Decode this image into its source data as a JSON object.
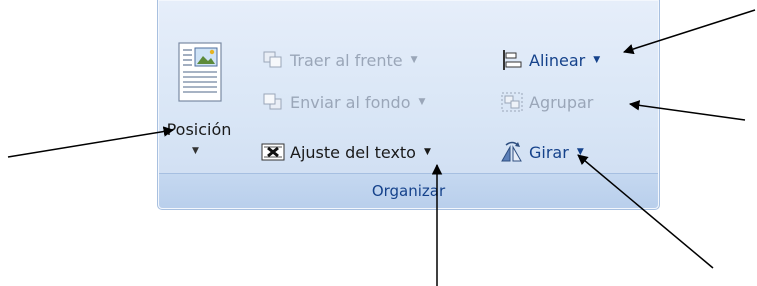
{
  "ribbon": {
    "group_label": "Organizar",
    "position": {
      "label": "Posición",
      "icon": "position-icon"
    },
    "buttons": {
      "bring_front": {
        "label": "Traer al frente",
        "icon": "bring-to-front-icon",
        "enabled": false
      },
      "send_back": {
        "label": "Enviar al fondo",
        "icon": "send-to-back-icon",
        "enabled": false
      },
      "text_wrap": {
        "label": "Ajuste del texto",
        "icon": "text-wrap-icon",
        "enabled": true
      },
      "align": {
        "label": "Alinear",
        "icon": "align-icon",
        "enabled": true
      },
      "group": {
        "label": "Agrupar",
        "icon": "group-icon",
        "enabled": false
      },
      "rotate": {
        "label": "Girar",
        "icon": "rotate-icon",
        "enabled": true
      }
    }
  },
  "colors": {
    "accent": "#15428b",
    "disabled": "#9aa6b8",
    "ribbon_bg": "#dfe9f7"
  }
}
